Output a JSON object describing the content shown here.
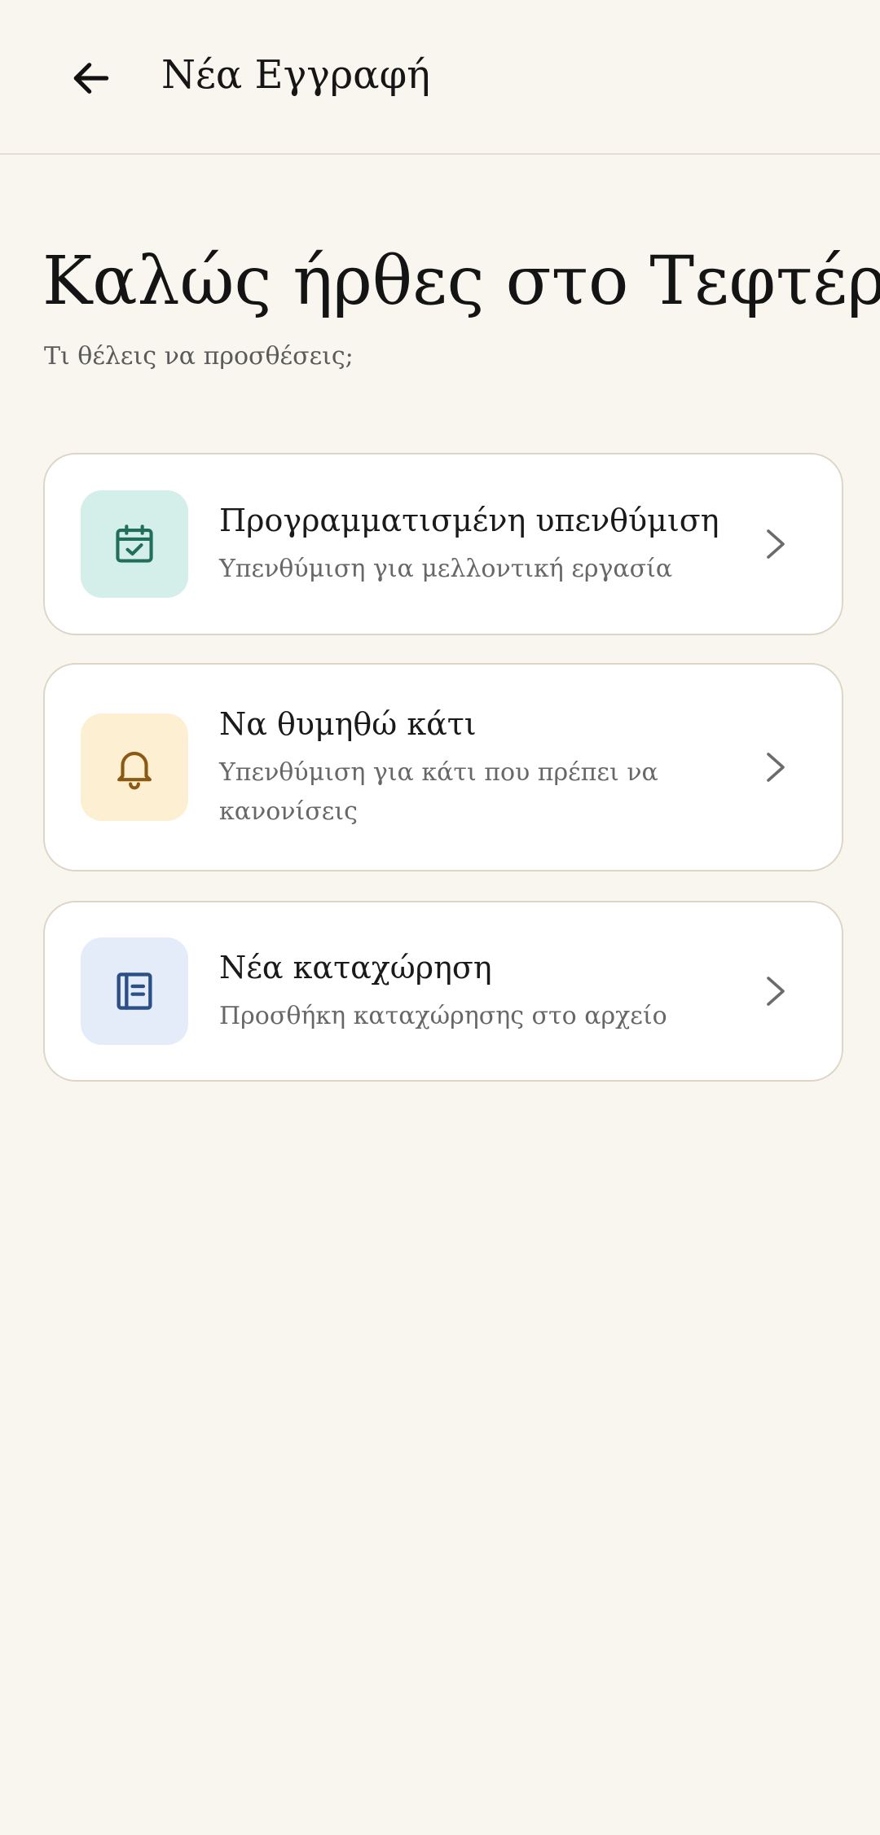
{
  "app_bar": {
    "title": "Νέα Εγγραφή",
    "back_icon": "arrow-left-icon"
  },
  "welcome": {
    "title": "Καλώς ήρθες στο Τεφτέρι",
    "subtitle": "Τι θέλεις να προσθέσεις;"
  },
  "options": [
    {
      "title": "Προγραμματισμένη υπενθύμιση",
      "description": "Υπενθύμιση για μελλοντική εργασία",
      "icon": "calendar-check-icon",
      "icon_color": "#1f6f5c",
      "icon_bg": "#d4efe9"
    },
    {
      "title": "Να θυμηθώ κάτι",
      "description": "Υπενθύμιση για κάτι που πρέπει να κανονίσεις",
      "icon": "bell-icon",
      "icon_color": "#8a5a12",
      "icon_bg": "#fdefd2"
    },
    {
      "title": "Νέα καταχώρηση",
      "description": "Προσθήκη καταχώρησης στο αρχείο",
      "icon": "notebook-icon",
      "icon_color": "#2b4f86",
      "icon_bg": "#e3ecf8"
    }
  ],
  "colors": {
    "background": "#f9f6f0",
    "card_border": "#ddd5c6",
    "chevron": "#6b6b6b"
  }
}
